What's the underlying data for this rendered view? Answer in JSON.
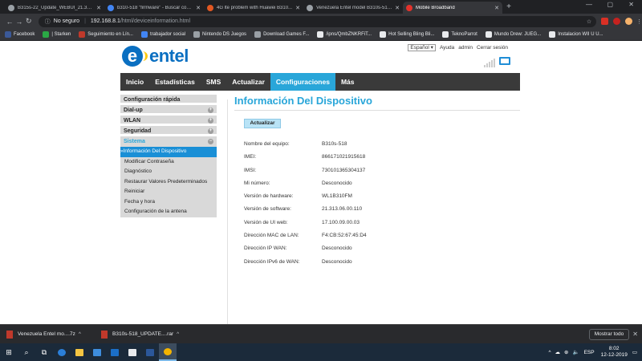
{
  "browser": {
    "tabs": [
      {
        "title": "B315s-22_Update_WEBUI_21.313...",
        "color": "#9aa0a6",
        "active": false
      },
      {
        "title": "b310-518 \"firmware\" - Buscar con G...",
        "color": "#4285f4",
        "active": false
      },
      {
        "title": "4G lte problem with Huawei B310...",
        "color": "#e25822",
        "active": false
      },
      {
        "title": "Venezuela Entel model B310s-518...",
        "color": "#9aa0a6",
        "active": false
      },
      {
        "title": "Mobile Broadband",
        "color": "#e4322b",
        "active": true
      }
    ],
    "security_label": "No seguro",
    "url_host": "192.168.8.1",
    "url_path": "/html/deviceinformation.html",
    "bookmarks": [
      {
        "label": "Facebook",
        "color": "#3b5998"
      },
      {
        "label": "| Starken",
        "color": "#2aa845"
      },
      {
        "label": "Seguimiento en Lín...",
        "color": "#c0392b"
      },
      {
        "label": "trabajador social",
        "color": "#4285f4"
      },
      {
        "label": "Nintendo DS Juegos",
        "color": "#9aa0a6"
      },
      {
        "label": "Download Games F...",
        "color": "#9aa0a6"
      },
      {
        "label": "/ipns/QmbZNKRFiT...",
        "color": "#e8eaed"
      },
      {
        "label": "Hot Selling Bling Bli...",
        "color": "#e8eaed"
      },
      {
        "label": "TeknoParrot",
        "color": "#e8eaed"
      },
      {
        "label": "Mundo Drew: JUEG...",
        "color": "#e8eaed"
      },
      {
        "label": "Instalacion WII U U...",
        "color": "#e8eaed"
      }
    ]
  },
  "router": {
    "brand": "entel",
    "language": "Español",
    "help_link": "Ayuda",
    "user_link": "admin",
    "logout_link": "Cerrar sesión",
    "nav": [
      {
        "label": "Inicio",
        "active": false
      },
      {
        "label": "Estadísticas",
        "active": false
      },
      {
        "label": "SMS",
        "active": false
      },
      {
        "label": "Actualizar",
        "active": false
      },
      {
        "label": "Configuraciones",
        "active": true
      },
      {
        "label": "Más",
        "active": false
      }
    ],
    "sidebar": {
      "quick_setup": "Configuración rápida",
      "dialup": "Dial-up",
      "wlan": "WLAN",
      "security": "Seguridad",
      "system": "Sistema",
      "system_items": [
        {
          "label": "Información Del Dispositivo",
          "active": true
        },
        {
          "label": "Modificar Contraseña",
          "active": false
        },
        {
          "label": "Diagnóstico",
          "active": false
        },
        {
          "label": "Restaurar Valores Predeterminados",
          "active": false
        },
        {
          "label": "Reiniciar",
          "active": false
        },
        {
          "label": "Fecha y hora",
          "active": false
        },
        {
          "label": "Configuración de la antena",
          "active": false
        }
      ]
    },
    "page_title": "Información Del Dispositivo",
    "refresh_label": "Actualizar",
    "device_info": [
      {
        "label": "Nombre del equipo:",
        "value": "B310s-518"
      },
      {
        "label": "IMEI:",
        "value": "866171021915618"
      },
      {
        "label": "IMSI:",
        "value": "730101365304137"
      },
      {
        "label": "Mi número:",
        "value": "Desconocido"
      },
      {
        "label": "Versión de hardware:",
        "value": "WL1B310FM"
      },
      {
        "label": "Versión de software:",
        "value": "21.313.06.00.110"
      },
      {
        "label": "Versión de UI web:",
        "value": "17.100.09.00.03"
      },
      {
        "label": "Dirección MAC de LAN:",
        "value": "F4:CB:52:67:45:D4"
      },
      {
        "label": "Dirección IP WAN:",
        "value": "Desconocido"
      },
      {
        "label": "Dirección IPv6 de WAN:",
        "value": "Desconocido"
      }
    ]
  },
  "downloads": {
    "items": [
      "Venezuela Entel mo....7z",
      "B310s-518_UPDATE....rar"
    ],
    "show_all": "Mostrar todo"
  },
  "taskbar": {
    "language": "ESP",
    "time": "8:02",
    "date": "12-12-2019"
  }
}
